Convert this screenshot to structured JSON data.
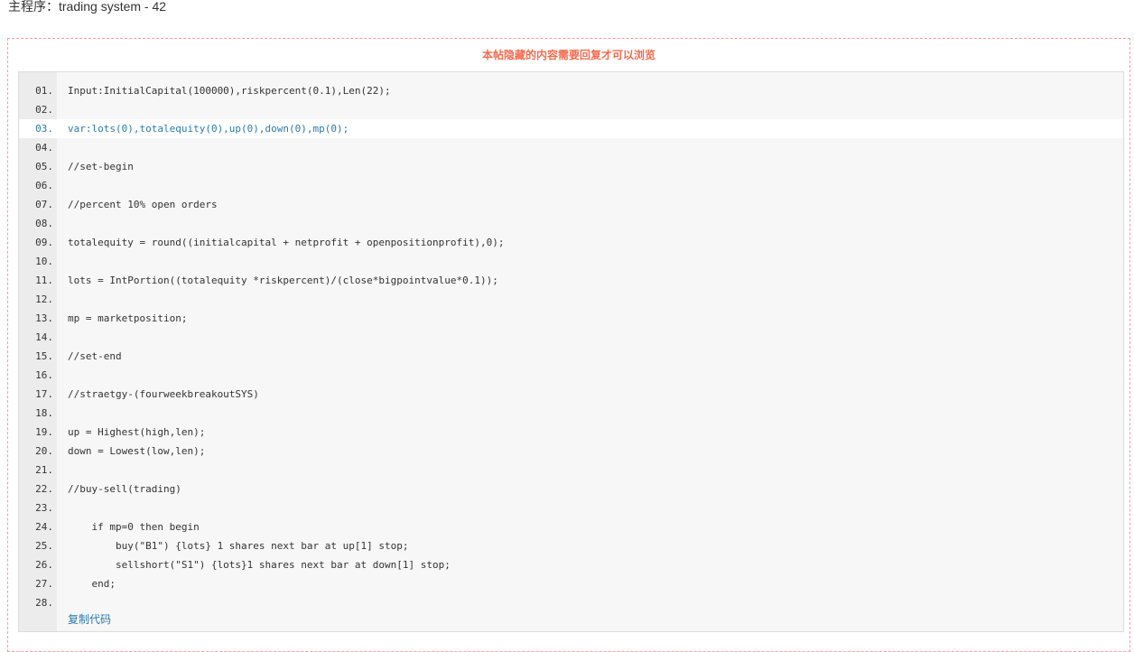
{
  "post": {
    "title": "主程序：trading system - 42"
  },
  "hidden_content": {
    "notice": "本帖隐藏的内容需要回复才可以浏览"
  },
  "code": {
    "copy_label": "复制代码",
    "highlighted_line": "03.",
    "lines": [
      {
        "num": "01.",
        "text": "Input:InitialCapital(100000),riskpercent(0.1),Len(22);"
      },
      {
        "num": "02.",
        "text": ""
      },
      {
        "num": "03.",
        "text": "var:lots(0),totalequity(0),up(0),down(0),mp(0);"
      },
      {
        "num": "04.",
        "text": ""
      },
      {
        "num": "05.",
        "text": "//set-begin"
      },
      {
        "num": "06.",
        "text": ""
      },
      {
        "num": "07.",
        "text": "//percent 10% open orders"
      },
      {
        "num": "08.",
        "text": ""
      },
      {
        "num": "09.",
        "text": "totalequity = round((initialcapital + netprofit + openpositionprofit),0);"
      },
      {
        "num": "10.",
        "text": ""
      },
      {
        "num": "11.",
        "text": "lots = IntPortion((totalequity *riskpercent)/(close*bigpointvalue*0.1));"
      },
      {
        "num": "12.",
        "text": ""
      },
      {
        "num": "13.",
        "text": "mp = marketposition;"
      },
      {
        "num": "14.",
        "text": ""
      },
      {
        "num": "15.",
        "text": "//set-end"
      },
      {
        "num": "16.",
        "text": ""
      },
      {
        "num": "17.",
        "text": "//straetgy-(fourweekbreakoutSYS)"
      },
      {
        "num": "18.",
        "text": ""
      },
      {
        "num": "19.",
        "text": "up = Highest(high,len);"
      },
      {
        "num": "20.",
        "text": "down = Lowest(low,len);"
      },
      {
        "num": "21.",
        "text": ""
      },
      {
        "num": "22.",
        "text": "//buy-sell(trading)"
      },
      {
        "num": "23.",
        "text": ""
      },
      {
        "num": "24.",
        "text": "    if mp=0 then begin"
      },
      {
        "num": "25.",
        "text": "        buy(\"B1\") {lots} 1 shares next bar at up[1] stop;"
      },
      {
        "num": "26.",
        "text": "        sellshort(\"S1\") {lots}1 shares next bar at down[1] stop;"
      },
      {
        "num": "27.",
        "text": "    end;"
      },
      {
        "num": "28.",
        "text": ""
      }
    ]
  }
}
